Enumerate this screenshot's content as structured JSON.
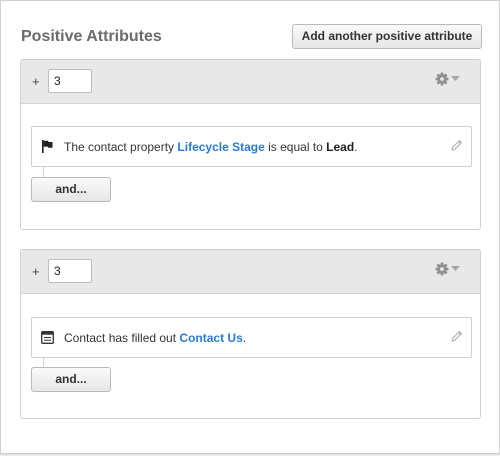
{
  "header": {
    "title": "Positive Attributes",
    "add_button_label": "Add another positive attribute"
  },
  "groups": [
    {
      "plus": "+",
      "points_value": "3",
      "condition": {
        "icon": "flag-icon",
        "prefix": "The contact property",
        "link": "Lifecycle Stage",
        "middle": "is equal to",
        "value": "Lead",
        "suffix": "."
      },
      "and_button_label": "and..."
    },
    {
      "plus": "+",
      "points_value": "3",
      "condition": {
        "icon": "form-icon",
        "prefix": "Contact has filled out",
        "link": "Contact Us",
        "suffix": "."
      },
      "and_button_label": "and..."
    }
  ],
  "colors": {
    "link": "#2a7ccf",
    "header_bg": "#e8e8e8",
    "title": "#6b6b6b"
  }
}
